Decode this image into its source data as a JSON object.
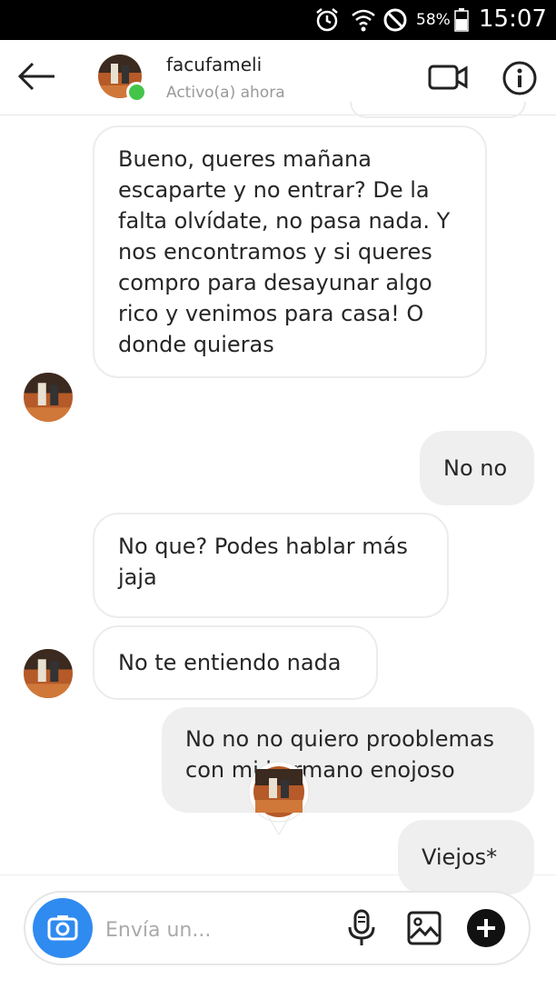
{
  "status_bar": {
    "battery_pct": "58%",
    "time": "15:07"
  },
  "header": {
    "username": "facufameli",
    "presence": "Activo(a) ahora"
  },
  "messages": [
    {
      "side": "received",
      "text": "Bueno, queres mañana escaparte y no entrar? De la falta olvídate, no pasa nada. Y nos encontramos y si queres compro para desayunar algo rico y venimos para casa! O donde quieras"
    },
    {
      "side": "sent",
      "text": "No no"
    },
    {
      "side": "received",
      "text": "No que? Podes hablar más jaja"
    },
    {
      "side": "received",
      "text": "No te entiendo nada"
    },
    {
      "side": "sent",
      "text": "No no no quiero prooblemas con mi hermano enojoso"
    },
    {
      "side": "sent",
      "text": "Viejos*"
    }
  ],
  "composer": {
    "placeholder": "Envía un..."
  },
  "colors": {
    "accent": "#2f8bf0",
    "online": "#44c54a",
    "sent_bubble": "#efefef"
  }
}
